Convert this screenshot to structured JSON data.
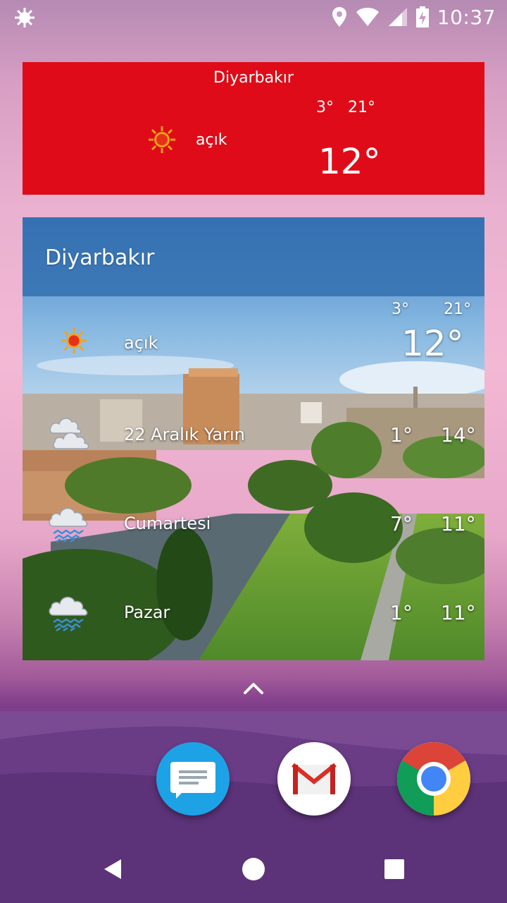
{
  "status_bar": {
    "time": "10:37",
    "icons": [
      "weather-sun-icon",
      "location-pin-icon",
      "wifi-icon",
      "signal-icon",
      "battery-charging-icon"
    ]
  },
  "widget_small": {
    "city": "Diyarbakır",
    "low": "3°",
    "high": "21°",
    "condition": "açık",
    "temperature": "12°",
    "icon": "sun-icon",
    "background_color": "#e00b18"
  },
  "widget_large": {
    "city": "Diyarbakır",
    "low": "3°",
    "high": "21°",
    "condition": "açık",
    "temperature": "12°",
    "icon": "sun-icon",
    "header_color": "#3470b0",
    "forecast": [
      {
        "day": "22 Aralık Yarın",
        "low": "1°",
        "high": "14°",
        "icon": "cloud-icon"
      },
      {
        "day": "Cumartesi",
        "low": "7°",
        "high": "11°",
        "icon": "rain-cloud-icon"
      },
      {
        "day": "Pazar",
        "low": "1°",
        "high": "11°",
        "icon": "rain-cloud-icon"
      }
    ]
  },
  "dock": {
    "apps": [
      {
        "name": "Messages",
        "icon": "messages-icon"
      },
      {
        "name": "Gmail",
        "icon": "gmail-icon"
      },
      {
        "name": "Chrome",
        "icon": "chrome-icon"
      }
    ]
  },
  "nav_bar": {
    "buttons": [
      "back-icon",
      "home-icon",
      "recents-icon"
    ]
  }
}
